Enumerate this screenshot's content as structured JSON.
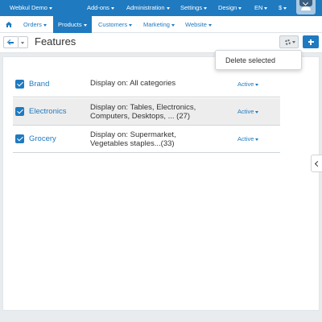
{
  "topbar": {
    "store": "Webkul Demo",
    "addons": "Add-ons",
    "administration": "Administration",
    "settings": "Settings",
    "design": "Design",
    "language": "EN",
    "currency": "$"
  },
  "nav": {
    "orders": "Orders",
    "products": "Products",
    "customers": "Customers",
    "marketing": "Marketing",
    "website": "Website"
  },
  "page": {
    "title": "Features"
  },
  "dropdown": {
    "delete_selected": "Delete selected"
  },
  "features": [
    {
      "name": "Brand",
      "display": "Display on: All categories",
      "status": "Active"
    },
    {
      "name": "Electronics",
      "display": "Display on: Tables, Electronics, Computers, Desktops, ... (27)",
      "status": "Active"
    },
    {
      "name": "Grocery",
      "display": "Display on: Supermarket, Vegetables staples...(33)",
      "status": "Active"
    }
  ],
  "colors": {
    "primary": "#1f7ac0",
    "hover_row": "#ededed"
  }
}
